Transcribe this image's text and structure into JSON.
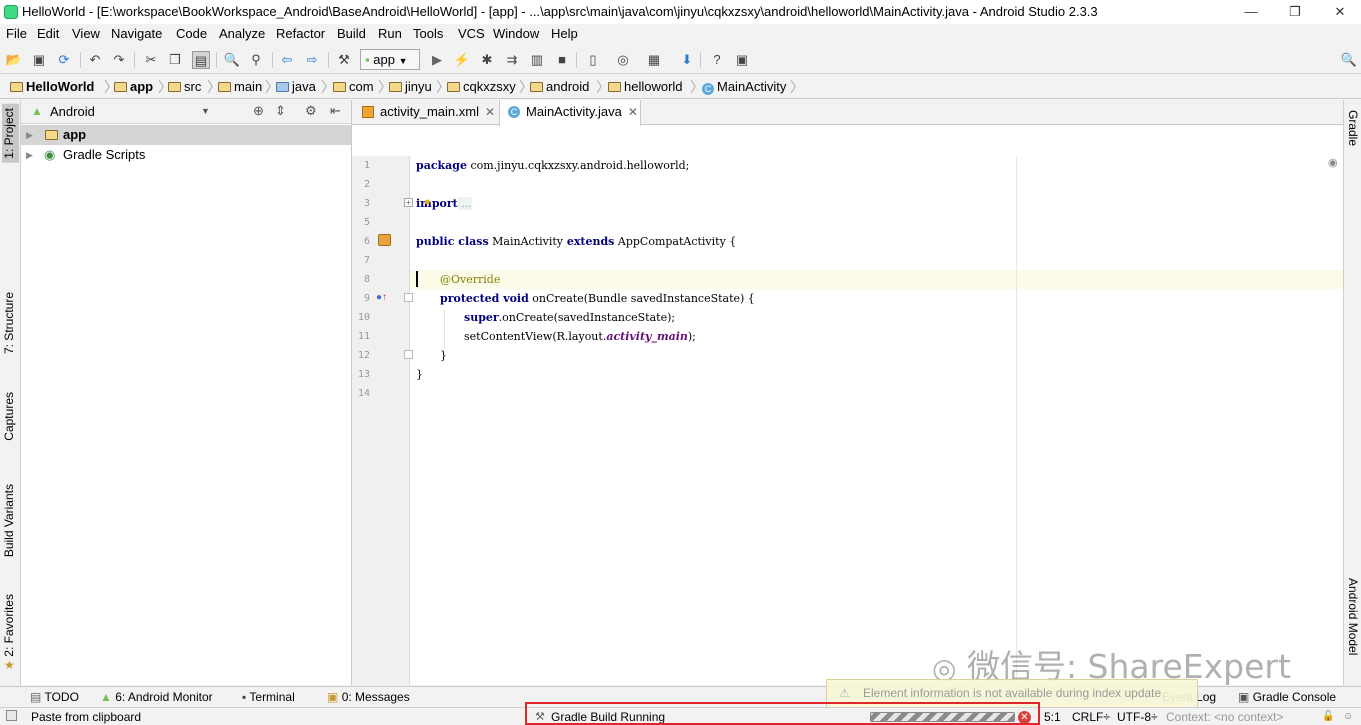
{
  "window": {
    "title": "HelloWorld - [E:\\workspace\\BookWorkspace_Android\\BaseAndroid\\HelloWorld] - [app] - ...\\app\\src\\main\\java\\com\\jinyu\\cqkxzsxy\\android\\helloworld\\MainActivity.java - Android Studio 2.3.3",
    "minimize": "—",
    "restore": "❐",
    "close": "✕"
  },
  "menu": [
    "File",
    "Edit",
    "View",
    "Navigate",
    "Code",
    "Analyze",
    "Refactor",
    "Build",
    "Run",
    "Tools",
    "VCS",
    "Window",
    "Help"
  ],
  "toolbar": {
    "run_config": "app",
    "icons": [
      "open-icon",
      "save-icon",
      "sync-icon",
      "undo-icon",
      "redo-icon",
      "cut-icon",
      "copy-icon",
      "paste-icon",
      "find-icon",
      "replace-icon",
      "back-icon",
      "forward-icon",
      "make-icon",
      "run-icon",
      "apply-changes-icon",
      "debug-icon",
      "attach-icon",
      "stop-icon",
      "avd-manager-icon",
      "sync-gradle-icon",
      "project-structure-icon",
      "sdk-manager-icon",
      "help-icon",
      "device-monitor-icon",
      "search-everywhere-icon"
    ]
  },
  "breadcrumbs": [
    "HelloWorld",
    "app",
    "src",
    "main",
    "java",
    "com",
    "jinyu",
    "cqkxzsxy",
    "android",
    "helloworld",
    "MainActivity"
  ],
  "left_tools": {
    "project": "1: Project",
    "structure": "7: Structure",
    "captures": "Captures",
    "build_variants": "Build Variants",
    "favorites": "2: Favorites"
  },
  "right_tools": {
    "gradle": "Gradle",
    "android_model": "Android Model"
  },
  "project_panel": {
    "view_mode": "Android",
    "tree": [
      {
        "label": "app",
        "selected": true
      },
      {
        "label": "Gradle Scripts",
        "selected": false
      }
    ]
  },
  "editor": {
    "tabs": [
      {
        "label": "activity_main.xml",
        "active": false
      },
      {
        "label": "MainActivity.java",
        "active": true
      }
    ],
    "line_numbers": [
      "1",
      "2",
      "3",
      "5",
      "6",
      "7",
      "8",
      "9",
      "10",
      "11",
      "12",
      "13",
      "14"
    ],
    "code": {
      "l1_kw": "package",
      "l1_rest": " com.jinyu.cqkxzsxy.android.helloworld;",
      "l3_kw": "import",
      "l3_fold": " ...",
      "l6_kw1": "public",
      "l6_kw2": " class",
      "l6_mid": " MainActivity",
      "l6_kw3": " extends",
      "l6_rest": " AppCompatActivity {",
      "l8_ann": "@Override",
      "l9_kw1": "protected",
      "l9_kw2": " void",
      "l9_rest": " onCreate(Bundle savedInstanceState) {",
      "l10_kw": "super",
      "l10_rest": ".onCreate(savedInstanceState);",
      "l11_a": "setContentView(R.layout.",
      "l11_it": "activity_main",
      "l11_b": ");",
      "l12": "}",
      "l13": "}"
    }
  },
  "bottom_tabs": [
    "TODO",
    "6: Android Monitor",
    "Terminal",
    "0: Messages",
    "Event Log",
    "Gradle Console"
  ],
  "status": {
    "message": "Paste from clipboard",
    "task": "Gradle Build Running",
    "position": "5:1",
    "line_sep": "CRLF÷",
    "encoding": "UTF-8÷",
    "context": "Context: <no context>",
    "balloon": "Element information is not available during index update"
  },
  "watermark": "微信号: ShareExpert",
  "colors": {
    "keyword": "#000080",
    "annotation": "#808000",
    "field_italic": "#660e7a",
    "highlight_box": "#e0262a"
  }
}
